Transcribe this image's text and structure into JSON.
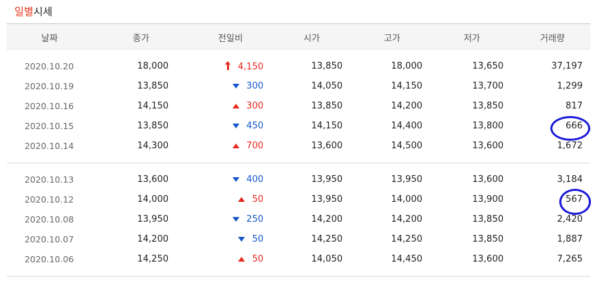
{
  "title": {
    "part1": "일별",
    "part2": "시세"
  },
  "headers": [
    "날짜",
    "종가",
    "전일비",
    "시가",
    "고가",
    "저가",
    "거래량"
  ],
  "rows": [
    {
      "date": "2020.10.20",
      "close": "18,000",
      "dir": "upper",
      "change": "4,150",
      "open": "13,850",
      "high": "18,000",
      "low": "13,650",
      "volume": "37,197"
    },
    {
      "date": "2020.10.19",
      "close": "13,850",
      "dir": "down",
      "change": "300",
      "open": "14,050",
      "high": "14,150",
      "low": "13,700",
      "volume": "1,299"
    },
    {
      "date": "2020.10.16",
      "close": "14,150",
      "dir": "up",
      "change": "300",
      "open": "13,850",
      "high": "14,200",
      "low": "13,850",
      "volume": "817"
    },
    {
      "date": "2020.10.15",
      "close": "13,850",
      "dir": "down",
      "change": "450",
      "open": "14,150",
      "high": "14,400",
      "low": "13,800",
      "volume": "666"
    },
    {
      "date": "2020.10.14",
      "close": "14,300",
      "dir": "up",
      "change": "700",
      "open": "13,600",
      "high": "14,500",
      "low": "13,600",
      "volume": "1,672"
    },
    {
      "date": "2020.10.13",
      "close": "13,600",
      "dir": "down",
      "change": "400",
      "open": "13,950",
      "high": "13,950",
      "low": "13,600",
      "volume": "3,184"
    },
    {
      "date": "2020.10.12",
      "close": "14,000",
      "dir": "up",
      "change": "50",
      "open": "13,950",
      "high": "14,000",
      "low": "13,900",
      "volume": "567"
    },
    {
      "date": "2020.10.08",
      "close": "13,950",
      "dir": "down",
      "change": "250",
      "open": "14,200",
      "high": "14,200",
      "low": "13,850",
      "volume": "2,420"
    },
    {
      "date": "2020.10.07",
      "close": "14,200",
      "dir": "down",
      "change": "50",
      "open": "14,250",
      "high": "14,250",
      "low": "13,850",
      "volume": "1,887"
    },
    {
      "date": "2020.10.06",
      "close": "14,250",
      "dir": "up",
      "change": "50",
      "open": "14,050",
      "high": "14,450",
      "low": "13,600",
      "volume": "7,265"
    }
  ],
  "annotations": {
    "circle_color": "#1a1ad8",
    "circled_volumes": [
      "666",
      "567"
    ]
  },
  "colors": {
    "title_accent": "#e8351d",
    "up": "#e8271d",
    "down": "#1457c8"
  }
}
